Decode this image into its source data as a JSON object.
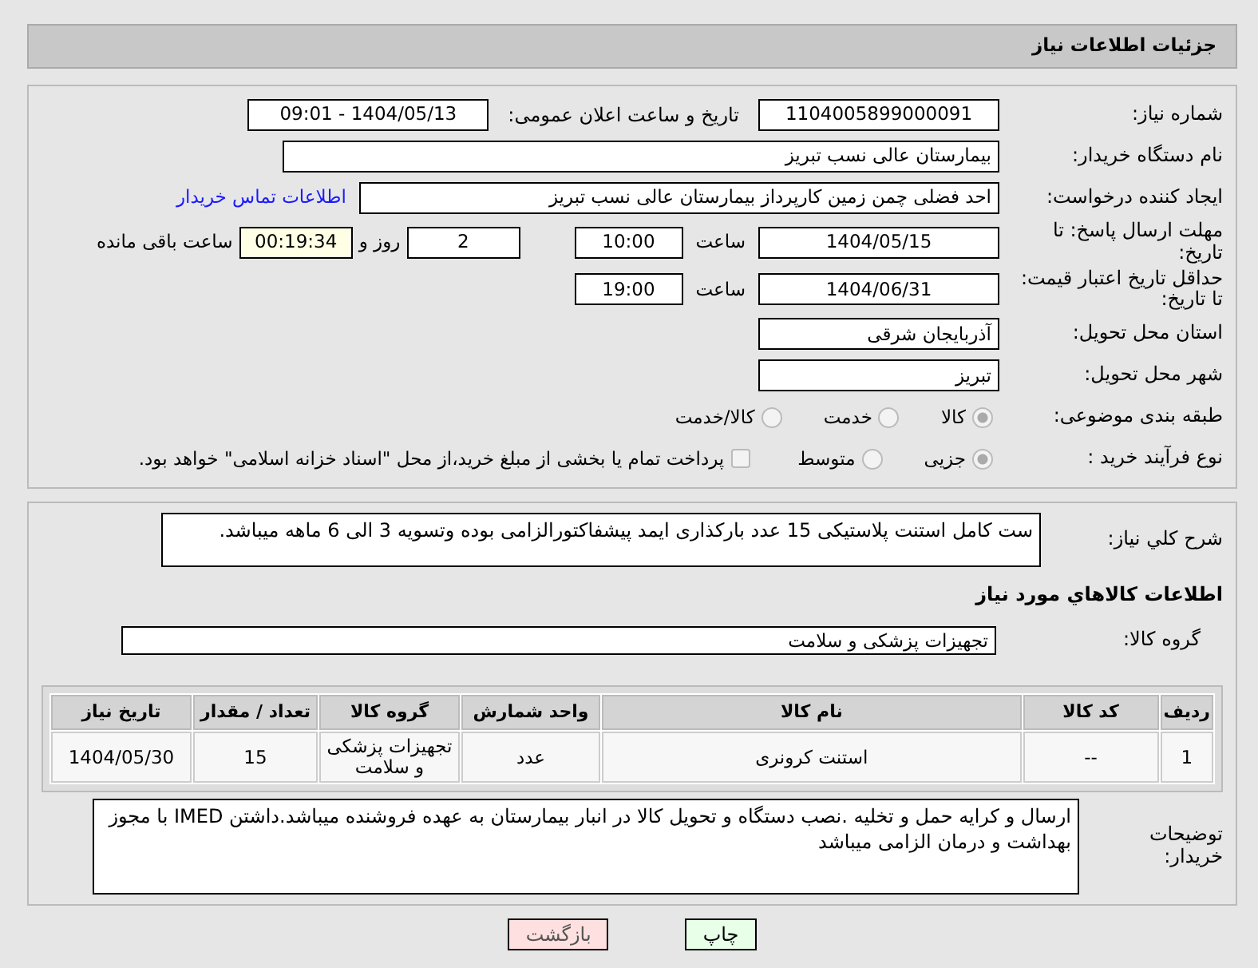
{
  "header": {
    "title": "جزئیات اطلاعات نیاز"
  },
  "need_number": {
    "label": "شماره نیاز:",
    "value": "1104005899000091"
  },
  "announce": {
    "label": "تاریخ و ساعت اعلان عمومی:",
    "value": "1404/05/13 - 09:01"
  },
  "buyer": {
    "label": "نام دستگاه خریدار:",
    "value": "بیمارستان عالی نسب تبریز"
  },
  "creator": {
    "label": "ایجاد کننده درخواست:",
    "value": "احد فضلی چمن زمین کارپرداز  بیمارستان عالی نسب تبریز",
    "link": "اطلاعات تماس خریدار"
  },
  "deadline": {
    "label": "مهلت ارسال پاسخ: تا تاریخ:",
    "date": "1404/05/15",
    "time_label": "ساعت",
    "time": "10:00",
    "days": "2",
    "days_label": "روز و",
    "remaining": "00:19:34",
    "remaining_label": "ساعت باقی مانده"
  },
  "validity": {
    "label": "حداقل تاریخ اعتبار قیمت: تا تاریخ:",
    "date": "1404/06/31",
    "time_label": "ساعت",
    "time": "19:00"
  },
  "province": {
    "label": "استان محل تحویل:",
    "value": "آذربایجان شرقی"
  },
  "city": {
    "label": "شهر محل تحویل:",
    "value": "تبریز"
  },
  "category": {
    "label": "طبقه بندی موضوعی:",
    "options": [
      {
        "label": "کالا",
        "selected": true
      },
      {
        "label": "خدمت",
        "selected": false
      },
      {
        "label": "کالا/خدمت",
        "selected": false
      }
    ]
  },
  "process": {
    "label": "نوع فرآیند خرید :",
    "options": [
      {
        "label": "جزیی",
        "selected": true
      },
      {
        "label": "متوسط",
        "selected": false
      }
    ],
    "treasury": {
      "checked": false,
      "label": "پرداخت تمام یا بخشی از مبلغ خرید،از محل \"اسناد خزانه اسلامی\" خواهد بود."
    }
  },
  "description": {
    "label": "شرح کلي نياز:",
    "value": "ست کامل استنت پلاستیکی 15 عدد بارکذاری ایمد پیشفاکتورالزامی بوده وتسویه 3 الی 6 ماهه میباشد."
  },
  "goods_heading": "اطلاعات کالاهاي مورد نياز",
  "goods_group": {
    "label": "گروه کالا:",
    "value": "تجهیزات پزشکی و سلامت"
  },
  "table": {
    "columns": [
      "ردیف",
      "کد کالا",
      "نام کالا",
      "واحد شمارش",
      "گروه کالا",
      "تعداد / مقدار",
      "تاریخ نیاز"
    ],
    "rows": [
      [
        "1",
        "--",
        "استنت کرونری",
        "عدد",
        "تجهیزات پزشکی و سلامت",
        "15",
        "1404/05/30"
      ]
    ]
  },
  "buyer_notes": {
    "label": "توضیحات خریدار:",
    "value": "ارسال و کرایه حمل و تخلیه .نصب دستگاه و تحویل کالا در انبار بیمارستان به عهده فروشنده میباشد.داشتن IMED با مجوز بهداشت و درمان الزامی میباشد"
  },
  "buttons": [
    {
      "kind": "print",
      "label": "چاپ"
    },
    {
      "kind": "back",
      "label": "بازگشت"
    }
  ]
}
